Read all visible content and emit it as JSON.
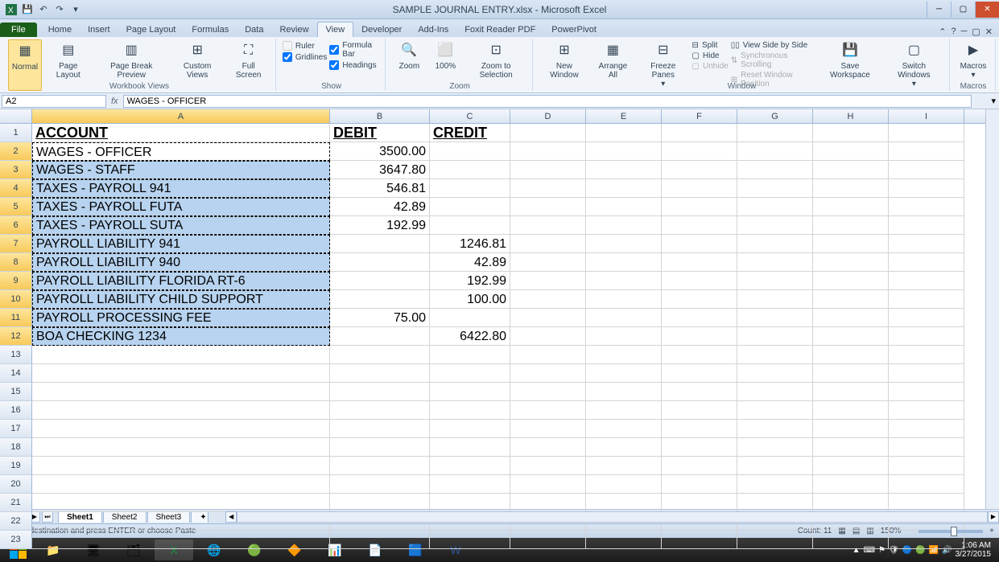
{
  "titlebar": {
    "title": "SAMPLE JOURNAL ENTRY.xlsx - Microsoft Excel"
  },
  "tabs": {
    "file": "File",
    "list": [
      "Home",
      "Insert",
      "Page Layout",
      "Formulas",
      "Data",
      "Review",
      "View",
      "Developer",
      "Add-Ins",
      "Foxit Reader PDF",
      "PowerPivot"
    ],
    "active": "View"
  },
  "ribbon": {
    "workbook_views": {
      "label": "Workbook Views",
      "normal": "Normal",
      "page_layout": "Page Layout",
      "page_break": "Page Break Preview",
      "custom": "Custom Views",
      "full": "Full Screen"
    },
    "show": {
      "label": "Show",
      "ruler": "Ruler",
      "formula_bar": "Formula Bar",
      "gridlines": "Gridlines",
      "headings": "Headings"
    },
    "zoom": {
      "label": "Zoom",
      "zoom": "Zoom",
      "hundred": "100%",
      "selection": "Zoom to Selection"
    },
    "window": {
      "label": "Window",
      "new": "New Window",
      "arrange": "Arrange All",
      "freeze": "Freeze Panes",
      "split": "Split",
      "hide": "Hide",
      "unhide": "Unhide",
      "side": "View Side by Side",
      "sync": "Synchronous Scrolling",
      "reset": "Reset Window Position",
      "save": "Save Workspace",
      "switch": "Switch Windows"
    },
    "macros": {
      "label": "Macros",
      "macros": "Macros"
    }
  },
  "namebox": "A2",
  "formula_bar": "WAGES - OFFICER",
  "columns": [
    "A",
    "B",
    "C",
    "D",
    "E",
    "F",
    "G",
    "H",
    "I"
  ],
  "headers": {
    "a": "ACCOUNT",
    "b": "DEBIT",
    "c": "CREDIT"
  },
  "rows": [
    {
      "n": 2,
      "a": "WAGES - OFFICER",
      "b": "3500.00",
      "c": ""
    },
    {
      "n": 3,
      "a": "WAGES - STAFF",
      "b": "3647.80",
      "c": ""
    },
    {
      "n": 4,
      "a": "TAXES - PAYROLL 941",
      "b": "546.81",
      "c": ""
    },
    {
      "n": 5,
      "a": "TAXES - PAYROLL FUTA",
      "b": "42.89",
      "c": ""
    },
    {
      "n": 6,
      "a": "TAXES - PAYROLL SUTA",
      "b": "192.99",
      "c": ""
    },
    {
      "n": 7,
      "a": "PAYROLL LIABILITY 941",
      "b": "",
      "c": "1246.81"
    },
    {
      "n": 8,
      "a": "PAYROLL LIABILITY 940",
      "b": "",
      "c": "42.89"
    },
    {
      "n": 9,
      "a": "PAYROLL LIABILITY FLORIDA RT-6",
      "b": "",
      "c": "192.99"
    },
    {
      "n": 10,
      "a": "PAYROLL LIABILITY CHILD SUPPORT",
      "b": "",
      "c": "100.00"
    },
    {
      "n": 11,
      "a": "PAYROLL PROCESSING FEE",
      "b": "75.00",
      "c": ""
    },
    {
      "n": 12,
      "a": "BOA CHECKING 1234",
      "b": "",
      "c": "6422.80"
    }
  ],
  "empty_rows": [
    13,
    14,
    15,
    16,
    17,
    18,
    19,
    20,
    21,
    22,
    23
  ],
  "sheets": {
    "list": [
      "Sheet1",
      "Sheet2",
      "Sheet3"
    ],
    "active": "Sheet1"
  },
  "status": {
    "msg": "Select destination and press ENTER or choose Paste",
    "count": "Count: 11",
    "zoom": "150%"
  },
  "tray": {
    "time": "1:06 AM",
    "date": "3/27/2015"
  }
}
